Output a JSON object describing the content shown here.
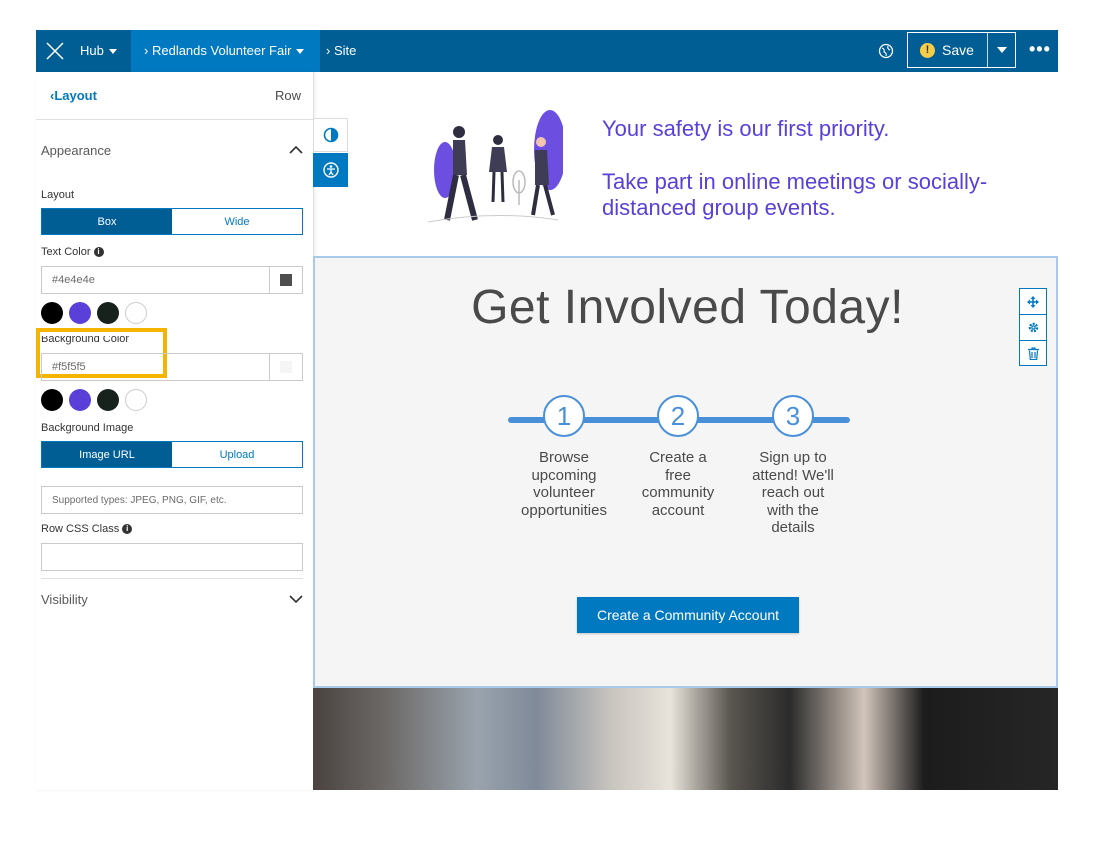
{
  "topbar": {
    "hub_label": "Hub",
    "site_crumb": "Redlands Volunteer Fair",
    "page_crumb": "Site",
    "save_label": "Save",
    "more_label": "•••"
  },
  "panel": {
    "back_label": "Layout",
    "context_label": "Row",
    "appearance_label": "Appearance",
    "layout_label": "Layout",
    "layout_options": [
      "Box",
      "Wide"
    ],
    "layout_selected": "Box",
    "text_color_label": "Text Color",
    "text_color_value": "#4e4e4e",
    "background_color_label": "Background Color",
    "background_color_value": "#f5f5f5",
    "background_image_label": "Background Image",
    "image_source_options": [
      "Image URL",
      "Upload"
    ],
    "image_url_placeholder": "Supported types: JPEG, PNG, GIF, etc.",
    "row_css_label": "Row CSS Class",
    "row_css_value": "",
    "visibility_label": "Visibility",
    "swatch_colors": [
      "#000000",
      "#5b3fd9",
      "#17221d",
      "#ffffff"
    ]
  },
  "content": {
    "safety_line1": "Your safety is our first priority.",
    "safety_line2": "Take part in online meetings or socially-distanced group events.",
    "title": "Get Involved Today!",
    "steps": [
      {
        "number": "1",
        "text": "Browse upcoming volunteer opportunities"
      },
      {
        "number": "2",
        "text": "Create a free community account"
      },
      {
        "number": "3",
        "text": "Sign up to attend! We'll reach out with the details"
      }
    ],
    "cta_label": "Create a Community Account"
  },
  "colors": {
    "brand_dark": "#005e95",
    "brand": "#0079c1",
    "accent_purple": "#5a3fd8",
    "highlight": "#f4b400"
  }
}
